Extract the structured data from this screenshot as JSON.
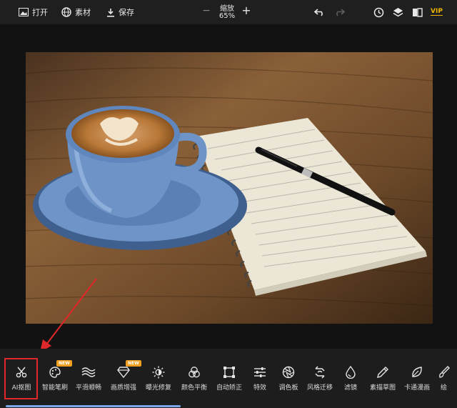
{
  "topbar": {
    "open_label": "打开",
    "material_label": "素材",
    "save_label": "保存",
    "zoom_label": "缩放",
    "zoom_value": "65%",
    "vip_label": "VIP"
  },
  "tools": [
    {
      "label": "AI抠图",
      "icon": "scissors-icon",
      "badge": ""
    },
    {
      "label": "智能笔刷",
      "icon": "palette-icon",
      "badge": "NEW"
    },
    {
      "label": "平滑顺畅",
      "icon": "waves-icon",
      "badge": ""
    },
    {
      "label": "画质增强",
      "icon": "diamond-icon",
      "badge": "NEW"
    },
    {
      "label": "曝光修复",
      "icon": "sun-icon",
      "badge": ""
    },
    {
      "label": "颜色平衡",
      "icon": "color-circles-icon",
      "badge": ""
    },
    {
      "label": "自动矫正",
      "icon": "crop-frame-icon",
      "badge": ""
    },
    {
      "label": "特效",
      "icon": "sliders-icon",
      "badge": ""
    },
    {
      "label": "调色板",
      "icon": "aperture-icon",
      "badge": ""
    },
    {
      "label": "风格迁移",
      "icon": "style-transfer-icon",
      "badge": ""
    },
    {
      "label": "滤镜",
      "icon": "drop-icon",
      "badge": ""
    },
    {
      "label": "素描草图",
      "icon": "pen-icon",
      "badge": ""
    },
    {
      "label": "卡通漫画",
      "icon": "leaf-icon",
      "badge": ""
    },
    {
      "label": "绘",
      "icon": "brush-icon",
      "badge": ""
    }
  ],
  "progress": {
    "value": 0.38
  },
  "colors": {
    "accent": "#f0b400",
    "highlight": "#e0282a",
    "progress": "#7aa8e8"
  }
}
